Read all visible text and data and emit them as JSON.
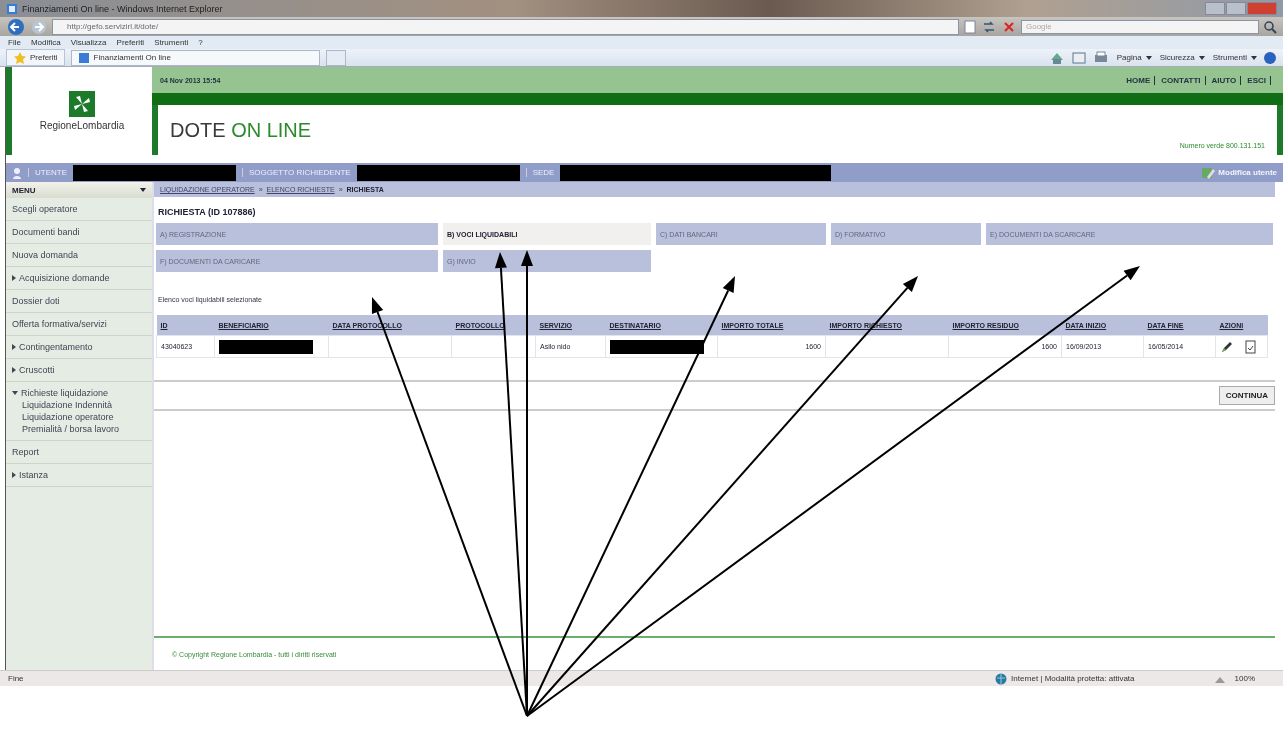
{
  "browser": {
    "title": "Finanziamenti On line - Windows Internet Explorer",
    "address": "http://gefo.servizirl.it/dote/",
    "search_placeholder": "Google",
    "menu": [
      "File",
      "Modifica",
      "Visualizza",
      "Preferiti",
      "Strumenti",
      "?"
    ],
    "favorites": "Preferiti",
    "tab": "Finanziamenti On line",
    "commands": [
      "Pagina",
      "Sicurezza",
      "Strumenti"
    ]
  },
  "header": {
    "logo_text": "RegioneLombardia",
    "date": "04 Nov 2013 15:54",
    "links": [
      "HOME",
      "CONTATTI",
      "AIUTO",
      "ESCI"
    ],
    "app_title_1": "DOTE",
    "app_title_2": "ON LINE",
    "phone": "Numero verde 800.131.151"
  },
  "user_bar": {
    "fields": [
      {
        "label": "UTENTE",
        "redacted": true
      },
      {
        "label": "SOGGETTO RICHIEDENTE",
        "redacted": true
      },
      {
        "label": "SEDE",
        "redacted": true
      }
    ],
    "action": "Modifica utente"
  },
  "sidebar": {
    "title": "MENU",
    "items": [
      {
        "label": "Scegli operatore"
      },
      {
        "label": "Documenti bandi"
      },
      {
        "label": "Nuova domanda"
      },
      {
        "label": "Acquisizione domande",
        "expanded": false
      },
      {
        "label": "Dossier doti"
      },
      {
        "label": "Offerta formativa/servizi"
      },
      {
        "label": "Contingentamento",
        "expanded": false
      },
      {
        "label": "Cruscotti",
        "expanded": false
      },
      {
        "label": "Richieste liquidazione",
        "expanded": true,
        "children": [
          {
            "label": "Liquidazione Indennità"
          },
          {
            "label": "Liquidazione operatore"
          },
          {
            "label": "Premialità / borsa lavoro"
          }
        ]
      },
      {
        "label": "Report"
      },
      {
        "label": "Istanza",
        "expanded": false
      }
    ]
  },
  "breadcrumb": {
    "separator": "»",
    "items": [
      {
        "label": "LIQUIDAZIONE OPERATORE",
        "link": true
      },
      {
        "label": "ELENCO RICHIESTE",
        "link": true
      },
      {
        "label": "RICHIESTA",
        "link": false
      }
    ]
  },
  "page_title": "RICHIESTA (ID 107886)",
  "tabs": [
    {
      "label": "A) REGISTRAZIONE",
      "selected": false
    },
    {
      "label": "B) VOCI LIQUIDABILI",
      "selected": true
    },
    {
      "label": "C) DATI BANCARI",
      "selected": false
    },
    {
      "label": "D) FORMATIVO",
      "selected": false
    },
    {
      "label": "E) DOCUMENTI DA SCARICARE",
      "selected": false
    },
    {
      "label": "F) DOCUMENTI DA CARICARE",
      "selected": false
    },
    {
      "label": "G) INVIO",
      "selected": false
    }
  ],
  "list_caption": "Elenco voci liquidabili selezionate",
  "table": {
    "columns": [
      {
        "label": "ID",
        "kind": "text"
      },
      {
        "label": "BENEFICIARIO",
        "kind": "text"
      },
      {
        "label": "DATA PROTOCOLLO",
        "kind": "text"
      },
      {
        "label": "PROTOCOLLO",
        "kind": "text"
      },
      {
        "label": "SERVIZIO",
        "kind": "text"
      },
      {
        "label": "DESTINATARIO",
        "kind": "text"
      },
      {
        "label": "IMPORTO TOTALE",
        "kind": "number"
      },
      {
        "label": "IMPORTO RICHIESTO",
        "kind": "number"
      },
      {
        "label": "IMPORTO RESIDUO",
        "kind": "number"
      },
      {
        "label": "DATA INIZIO",
        "kind": "text"
      },
      {
        "label": "DATA FINE",
        "kind": "text"
      },
      {
        "label": "AZIONI",
        "kind": "actions"
      }
    ],
    "rows": [
      {
        "cells": [
          "43040623",
          {
            "redacted": true
          },
          null,
          null,
          "Asilo nido",
          {
            "redacted": true
          },
          "1600",
          null,
          "1600",
          "16/09/2013",
          "16/05/2014",
          null
        ]
      }
    ]
  },
  "continue_button": "CONTINUA",
  "footer": "© Copyright Regione Lombardia - tutti i diritti riservati",
  "status_bar": {
    "text": "Fine",
    "zone": "Internet | Modalità protetta: attivata",
    "zoom": "100%"
  }
}
